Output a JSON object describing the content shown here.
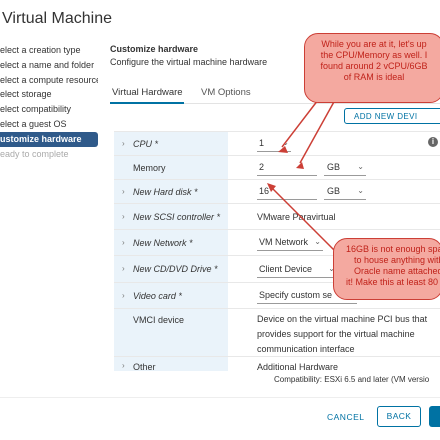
{
  "window": {
    "title": "Virtual Machine"
  },
  "steps": [
    {
      "label": "elect a creation type"
    },
    {
      "label": "elect a name and folder"
    },
    {
      "label": "elect a compute resource"
    },
    {
      "label": "elect storage"
    },
    {
      "label": "elect compatibility"
    },
    {
      "label": "elect a guest OS"
    },
    {
      "label": "ustomize hardware"
    },
    {
      "label": "eady to complete"
    }
  ],
  "section": {
    "title": "Customize hardware",
    "subtitle": "Configure the virtual machine hardware"
  },
  "tabs": [
    {
      "label": "Virtual Hardware"
    },
    {
      "label": "VM Options"
    }
  ],
  "add_device_label": "ADD NEW DEVI",
  "rows": [
    {
      "label": "CPU *",
      "value": "1"
    },
    {
      "label": "Memory",
      "value": "2",
      "unit": "GB"
    },
    {
      "label": "New Hard disk *",
      "value": "16",
      "unit": "GB"
    },
    {
      "label": "New SCSI controller *",
      "value": "VMware Paravirtual"
    },
    {
      "label": "New Network *",
      "value": "VM Network"
    },
    {
      "label": "New CD/DVD Drive *",
      "value": "Client Device"
    },
    {
      "label": "Video card *",
      "value": "Specify custom se"
    },
    {
      "label": "VMCI device",
      "desc": [
        "Device on the virtual machine PCI bus that",
        "provides support for the virtual machine",
        "communication interface"
      ]
    },
    {
      "label": "Other",
      "value": "Additional Hardware"
    }
  ],
  "compat_text": "Compatibility: ESXi 6.5 and later (VM versio",
  "buttons": {
    "cancel": "CANCEL",
    "back": "BACK"
  },
  "callouts": {
    "top": [
      "While you are at it, let's up",
      "the CPU/Memory as well. I",
      "found around 2 vCPU/6GB",
      "of RAM is ideal"
    ],
    "bottom": [
      "16GB is not enough spa",
      "to house anything with",
      "Oracle name attached",
      "it! Make this at least 80"
    ]
  },
  "colors": {
    "accent": "#0072a3",
    "active_step": "#2f5a8a",
    "callout_fill": "#f4a9a0",
    "callout_border": "#cc3f36",
    "callout_text": "#c0221a"
  }
}
